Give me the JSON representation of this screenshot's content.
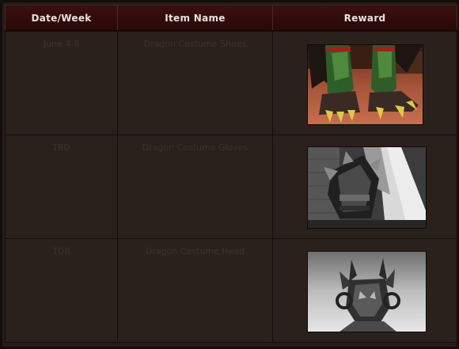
{
  "table": {
    "headers": [
      "Date/Week",
      "Item Name",
      "Reward"
    ],
    "rows": [
      {
        "date": "June 4-8",
        "item": "Dragon Costume Shoes",
        "reward_image": "dragon-costume-shoes-image"
      },
      {
        "date": "TBD",
        "item": "Dragon Costume Gloves",
        "reward_image": "dragon-costume-gloves-image"
      },
      {
        "date": "TDB",
        "item": "Dragon Costume Head",
        "reward_image": "dragon-costume-head-image"
      }
    ]
  },
  "colors": {
    "header_bg": "#2a0808",
    "header_text": "#e8e2dc",
    "cell_bg": "#2b211c",
    "cell_text": "#3c312b",
    "border": "#130e0c"
  }
}
